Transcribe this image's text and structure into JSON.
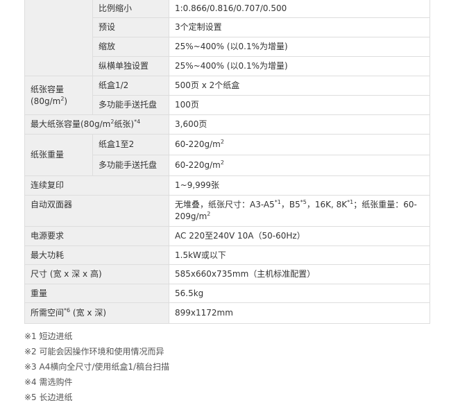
{
  "rows": [
    {
      "sub": "比例缩小",
      "val": "1:0.866/0.816/0.707/0.500"
    },
    {
      "sub": "预设",
      "val": "3个定制设置"
    },
    {
      "sub": "缩放",
      "val": "25%~400% (以0.1%为增量)"
    },
    {
      "sub": "纵横单独设置",
      "val": "25%~400% (以0.1%为增量)"
    }
  ],
  "capacity": {
    "label": "纸张容量",
    "label2_pre": "(80g/m",
    "label2_sup": "2",
    "label2_post": ")",
    "rows": [
      {
        "sub": "纸盒1/2",
        "val": "500页 x 2个纸盒"
      },
      {
        "sub": "多功能手送托盘",
        "val": "100页"
      }
    ]
  },
  "max_capacity": {
    "label_pre": "最大纸张容量(80g/m",
    "label_sup": "2",
    "label_mid": "纸张)",
    "label_sup2": "*4",
    "val": "3,600页"
  },
  "weight_paper": {
    "label": "纸张重量",
    "rows": [
      {
        "sub": "纸盒1至2",
        "val": "60-220g/m",
        "val_sup": "2"
      },
      {
        "sub": "多功能手送托盘",
        "val": "60-220g/m",
        "val_sup": "2"
      }
    ]
  },
  "continuous": {
    "label": "连续复印",
    "val": "1~9,999张"
  },
  "duplex": {
    "label": "自动双面器",
    "v1": "无堆叠，纸张尺寸：A3-A5",
    "s1": "*1",
    "v2": "，B5",
    "s2": "*5",
    "v3": "，16K, 8K",
    "s3": "*1",
    "v4": "；纸张重量：60-209g/m",
    "s4": "2"
  },
  "power": {
    "label": "电源要求",
    "val": "AC 220至240V 10A（50-60Hz）"
  },
  "max_power": {
    "label": "最大功耗",
    "val": "1.5kW或以下"
  },
  "size": {
    "label": "尺寸 (宽 x 深 x 高)",
    "val": "585x660x735mm（主机标准配置）"
  },
  "weight": {
    "label": "重量",
    "val": "56.5kg"
  },
  "space": {
    "label_pre": "所需空间",
    "label_sup": "*6",
    "label_post": " (宽 x 深)",
    "val": "899x1172mm"
  },
  "notes": [
    "※1 短边进纸",
    "※2 可能会因操作环境和使用情况而异",
    "※3 A4横向全尺寸/使用纸盒1/稿台扫描",
    "※4 需选购件",
    "※5 长边进纸"
  ]
}
